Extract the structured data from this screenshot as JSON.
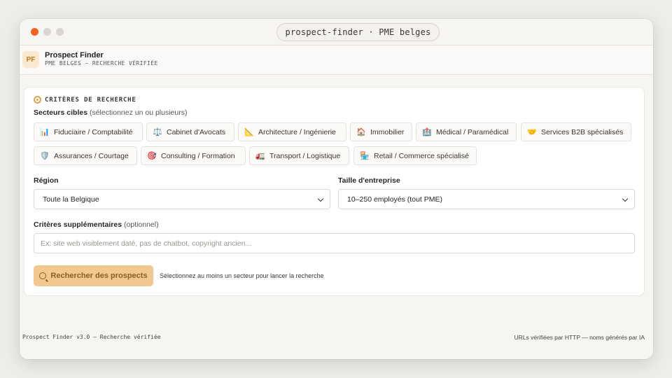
{
  "window": {
    "url": "prospect-finder · PME belges"
  },
  "header": {
    "logo": "PF",
    "title": "Prospect Finder",
    "subtitle": "PME BELGES — RECHERCHE VÉRIFIÉE"
  },
  "criteria": {
    "title": "CRITÈRES DE RECHERCHE",
    "sectors_label": "Secteurs cibles",
    "sectors_hint": "(sélectionnez un ou plusieurs)",
    "sectors": [
      {
        "label": "Fiduciaire / Comptabilité",
        "icon": "📊"
      },
      {
        "label": "Cabinet d'Avocats",
        "icon": "⚖️"
      },
      {
        "label": "Architecture / Ingénierie",
        "icon": "📐"
      },
      {
        "label": "Immobilier",
        "icon": "🏠"
      },
      {
        "label": "Médical / Paramédical",
        "icon": "🏥"
      },
      {
        "label": "Services B2B spécialisés",
        "icon": "🤝"
      },
      {
        "label": "Assurances / Courtage",
        "icon": "🛡️"
      },
      {
        "label": "Consulting / Formation",
        "icon": "🎯"
      },
      {
        "label": "Transport / Logistique",
        "icon": "🚛"
      },
      {
        "label": "Retail / Commerce spécialisé",
        "icon": "🏪"
      }
    ],
    "region_label": "Région",
    "region_value": "Toute la Belgique",
    "size_label": "Taille d'entreprise",
    "size_value": "10–250 employés (tout PME)",
    "extra_label": "Critères supplémentaires",
    "extra_hint": "(optionnel)",
    "extra_placeholder": "Ex: site web visiblement daté, pas de chatbot, copyright ancien...",
    "search_button": "Rechercher des prospects",
    "search_hint": "Sélectionnez au moins un secteur pour lancer la recherche"
  },
  "footer": {
    "left": "Prospect Finder v3.0 — Recherche vérifiée",
    "right": "URLs vérifiées par HTTP — noms générés par IA"
  },
  "colors": {
    "accent": "#f2c891",
    "close_dot": "#f2621f"
  }
}
